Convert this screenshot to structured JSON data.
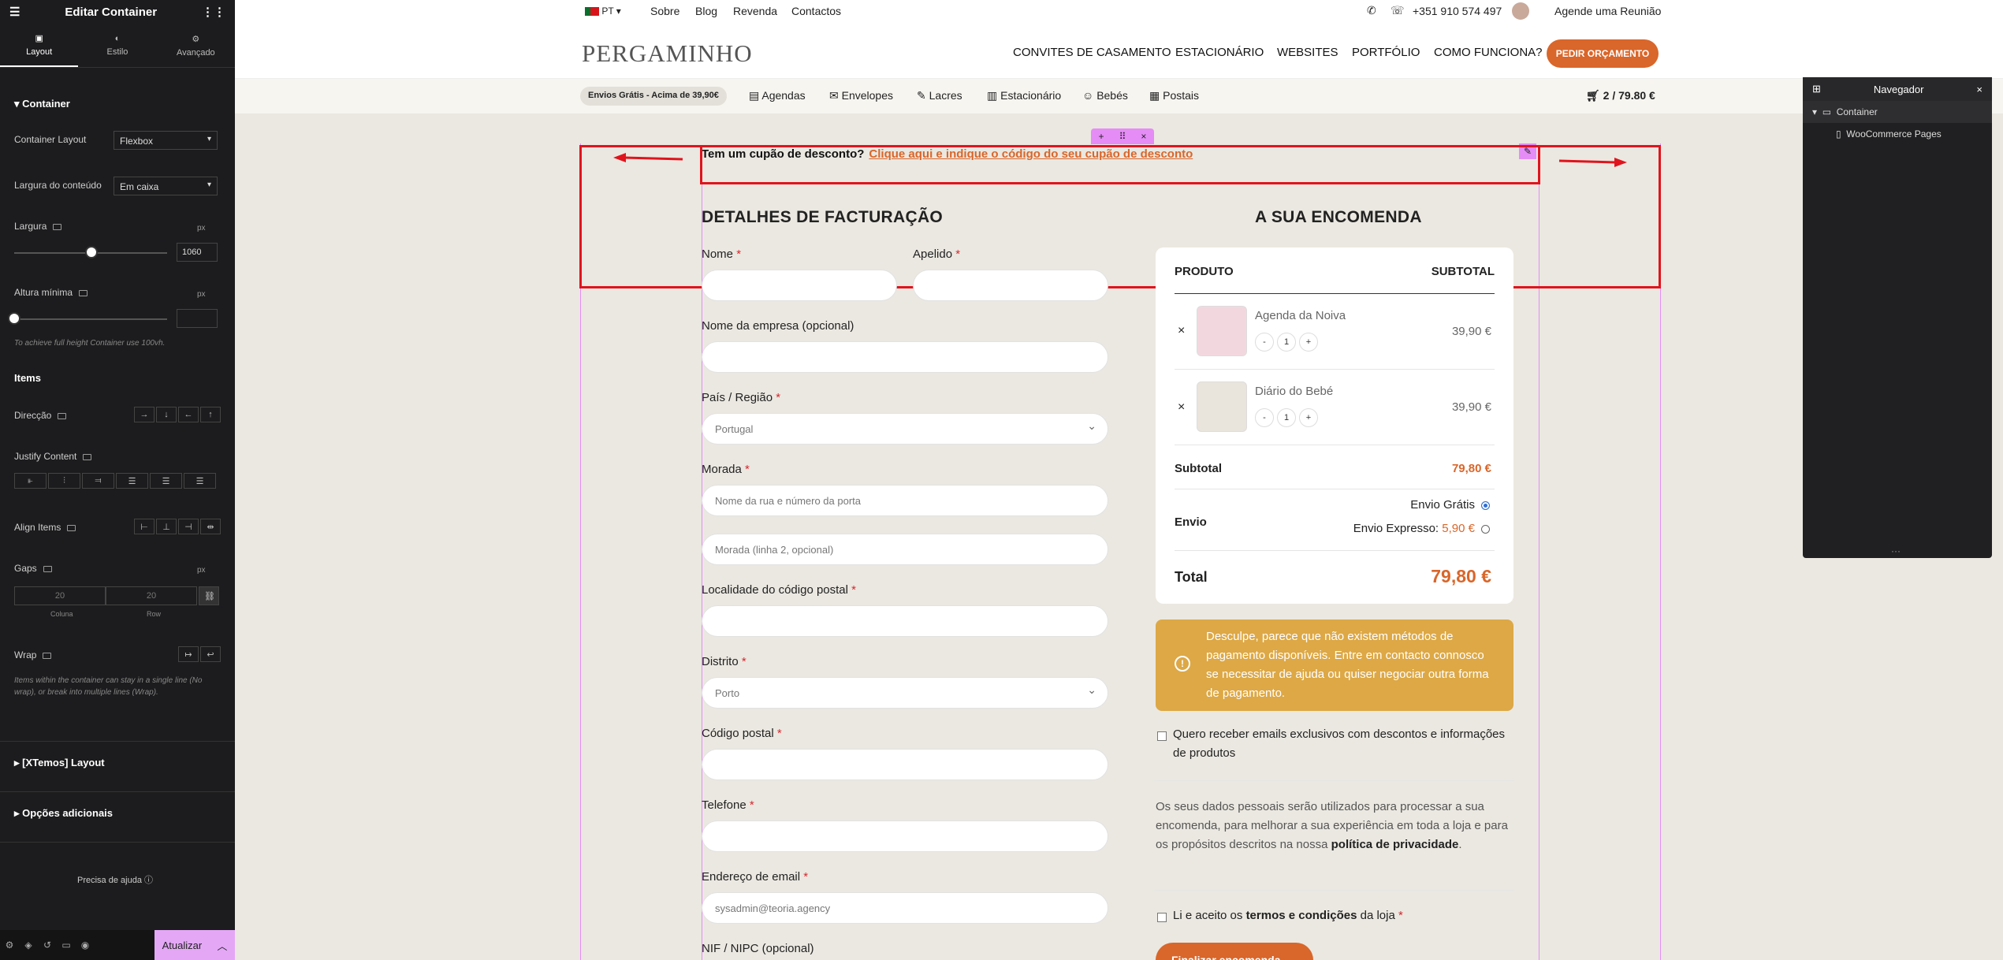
{
  "editor": {
    "title": "Editar Container",
    "tabs": [
      "Layout",
      "Estilo",
      "Avançado"
    ],
    "section_container": "Container",
    "container_layout_label": "Container Layout",
    "container_layout_value": "Flexbox",
    "content_width_label": "Largura do conteúdo",
    "content_width_value": "Em caixa",
    "width_label": "Largura",
    "width_unit": "px",
    "width_value": "1060",
    "min_height_label": "Altura mínima",
    "min_height_unit": "px",
    "min_height_value": "",
    "min_height_hint": "To achieve full height Container use 100vh.",
    "items_label": "Items",
    "direction_label": "Direcção",
    "justify_label": "Justify Content",
    "align_label": "Align Items",
    "gaps_label": "Gaps",
    "gaps_unit": "px",
    "gap_column": "20",
    "gap_row": "20",
    "gap_column_label": "Coluna",
    "gap_row_label": "Row",
    "wrap_label": "Wrap",
    "wrap_hint": "Items within the container can stay in a single line (No wrap), or break into multiple lines (Wrap).",
    "xtemos_section": "[XTemos] Layout",
    "extra_section": "Opções adicionais",
    "help_label": "Precisa de ajuda",
    "update_label": "Atualizar"
  },
  "topbar": {
    "lang": "PT",
    "links": [
      "Sobre",
      "Blog",
      "Revenda",
      "Contactos"
    ],
    "phone": "+351 910 574 497",
    "meeting": "Agende uma Reunião"
  },
  "header": {
    "logo": "PERGAMINHO",
    "nav": [
      "CONVITES DE CASAMENTO",
      "ESTACIONÁRIO",
      "WEBSITES",
      "PORTFÓLIO",
      "COMO FUNCIONA?"
    ],
    "cta": "PEDIR ORÇAMENTO"
  },
  "subnav": {
    "shipping_pill": "Envios Grátis - Acima de 39,90€",
    "items": [
      "Agendas",
      "Envelopes",
      "Lacres",
      "Estacionário",
      "Bebés",
      "Postais"
    ],
    "cart": "2 / 79.80 €"
  },
  "checkout": {
    "coupon_question": "Tem um cupão de desconto?",
    "coupon_link": "Clique aqui e indique o código do seu cupão de desconto",
    "billing_title": "DETALHES DE FACTURAÇÃO",
    "fields": {
      "first_name": "Nome",
      "last_name": "Apelido",
      "company": "Nome da empresa (opcional)",
      "country": "País / Região",
      "country_value": "Portugal",
      "address": "Morada",
      "address_placeholder": "Nome da rua e número da porta",
      "address2_placeholder": "Morada (linha 2, opcional)",
      "city": "Localidade do código postal",
      "district": "Distrito",
      "district_value": "Porto",
      "postcode": "Código postal",
      "phone": "Telefone",
      "email": "Endereço de email",
      "email_value": "sysadmin@teoria.agency",
      "nif": "NIF / NIPC (opcional)"
    },
    "required_mark": "*"
  },
  "order": {
    "title": "A SUA ENCOMENDA",
    "col_product": "PRODUTO",
    "col_subtotal": "SUBTOTAL",
    "items": [
      {
        "name": "Agenda da Noiva",
        "qty": "1",
        "price": "39,90 €"
      },
      {
        "name": "Diário do Bebé",
        "qty": "1",
        "price": "39,90 €"
      }
    ],
    "remove": "×",
    "minus": "-",
    "plus": "+",
    "subtotal_label": "Subtotal",
    "subtotal_value": "79,80 €",
    "shipping_label": "Envio",
    "ship_free": "Envio Grátis",
    "ship_express": "Envio Expresso:",
    "ship_express_price": "5,90 €",
    "total_label": "Total",
    "total_value": "79,80 €",
    "payment_warning": "Desculpe, parece que não existem métodos de pagamento disponíveis. Entre em contacto connosco se necessitar de ajuda ou quiser negociar outra forma de pagamento.",
    "newsletter": "Quero receber emails exclusivos com descontos e informações de produtos",
    "privacy_text": "Os seus dados pessoais serão utilizados para processar a sua encomenda, para melhorar a sua experiência em toda a loja e para os propósitos descritos na nossa",
    "privacy_link": "política de privacidade",
    "terms_pre": "Li e aceito os",
    "terms_link": "termos e condições",
    "terms_post": "da loja",
    "place_order": "Finalizar encomenda"
  },
  "navigator": {
    "title": "Navegador",
    "root": "Container",
    "child": "WooCommerce Pages"
  },
  "colors": {
    "accent": "#d9662a",
    "editor_purple": "#e58cf6",
    "annotation_red": "#e0141d",
    "warning": "#dda845"
  }
}
